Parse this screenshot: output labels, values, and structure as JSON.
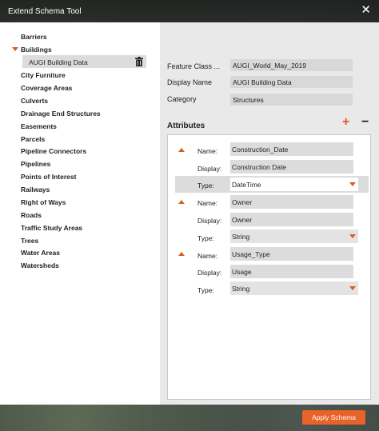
{
  "window": {
    "title": "Extend Schema Tool"
  },
  "sidebar": {
    "items": [
      {
        "label": "Barriers"
      },
      {
        "label": "Buildings",
        "expanded": true,
        "children": [
          {
            "label": "AUGI Building Data",
            "selected": true
          }
        ]
      },
      {
        "label": "City Furniture"
      },
      {
        "label": "Coverage Areas"
      },
      {
        "label": "Culverts"
      },
      {
        "label": "Drainage End Structures"
      },
      {
        "label": "Easements"
      },
      {
        "label": "Parcels"
      },
      {
        "label": "Pipeline Connectors"
      },
      {
        "label": "Pipelines"
      },
      {
        "label": "Points of Interest"
      },
      {
        "label": "Railways"
      },
      {
        "label": "Right of Ways"
      },
      {
        "label": "Roads"
      },
      {
        "label": "Traffic Study Areas"
      },
      {
        "label": "Trees"
      },
      {
        "label": "Water Areas"
      },
      {
        "label": "Watersheds"
      }
    ]
  },
  "properties": {
    "feature_class_label": "Feature Class ...",
    "feature_class_value": "AUGI_World_May_2019",
    "display_name_label": "Display Name",
    "display_name_value": "AUGI Building Data",
    "category_label": "Category",
    "category_value": "Structures"
  },
  "attributes": {
    "heading": "Attributes",
    "name_label": "Name:",
    "display_label": "Display:",
    "type_label": "Type:",
    "list": [
      {
        "name": "Construction_Date",
        "display": "Construction Date",
        "type": "DateTime",
        "highlighted": true
      },
      {
        "name": "Owner",
        "display": "Owner",
        "type": "String",
        "highlighted": false
      },
      {
        "name": "Usage_Type",
        "display": "Usage",
        "type": "String",
        "highlighted": false
      }
    ]
  },
  "footer": {
    "apply_label": "Apply Schema"
  },
  "icons": {
    "close": "close-icon",
    "trash": "trash-icon",
    "add": "plus-icon",
    "remove": "minus-icon",
    "expand": "caret-down-icon",
    "move_up": "arrow-up-icon",
    "dropdown": "chevron-down-icon"
  },
  "colors": {
    "accent": "#e8622a",
    "titlebar": "#262826",
    "panel": "#ffffff",
    "main_bg": "#e9e9e9"
  }
}
